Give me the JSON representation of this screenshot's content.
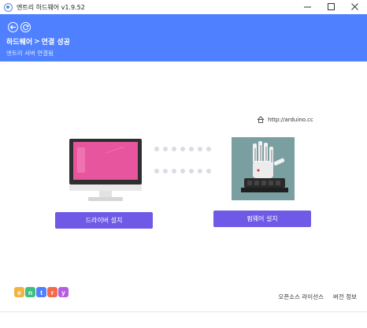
{
  "window": {
    "title": "엔트리 하드웨어 v1.9.52",
    "controls": [
      "minimize",
      "maximize",
      "close"
    ]
  },
  "header": {
    "breadcrumb_root": "하드웨어",
    "breadcrumb_separator": ">",
    "breadcrumb_current": "연결 성공",
    "subtitle": "엔트리 서버 연결됨",
    "background_color": "#4f80ff"
  },
  "main": {
    "url_text": "http://arduino.cc",
    "driver_button": "드라이버 설치",
    "firmware_button": "펌웨어 설치",
    "button_color": "#6e5ae6",
    "monitor_screen_color": "#e8559f",
    "board_image": "arduino-robot-hand"
  },
  "footer": {
    "logo_letters": [
      "e",
      "n",
      "t",
      "r",
      "y"
    ],
    "logo_colors": [
      "#f2b43e",
      "#3fbf7f",
      "#4f80ff",
      "#f26b4a",
      "#b35de0"
    ],
    "opensource_license": "오픈소스 라이선스",
    "version_info": "버전 정보"
  }
}
